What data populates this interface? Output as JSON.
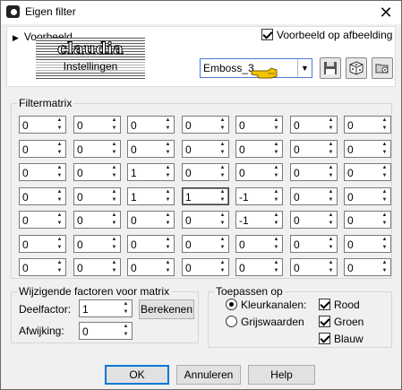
{
  "window": {
    "title": "Eigen filter"
  },
  "preview": {
    "toggle_label": "Voorbeeld",
    "show_on_image_label": "Voorbeeld op afbeelding",
    "show_on_image_checked": true
  },
  "logo": {
    "line1": "claudia",
    "line2": "Instellingen"
  },
  "preset": {
    "selected": "Emboss_3"
  },
  "matrix": {
    "legend": "Filtermatrix",
    "rows": [
      [
        "0",
        "0",
        "0",
        "0",
        "0",
        "0",
        "0"
      ],
      [
        "0",
        "0",
        "0",
        "0",
        "0",
        "0",
        "0"
      ],
      [
        "0",
        "0",
        "1",
        "0",
        "0",
        "0",
        "0"
      ],
      [
        "0",
        "0",
        "1",
        "1",
        "-1",
        "0",
        "0"
      ],
      [
        "0",
        "0",
        "0",
        "0",
        "-1",
        "0",
        "0"
      ],
      [
        "0",
        "0",
        "0",
        "0",
        "0",
        "0",
        "0"
      ],
      [
        "0",
        "0",
        "0",
        "0",
        "0",
        "0",
        "0"
      ]
    ]
  },
  "factors": {
    "legend": "Wijzigende factoren voor matrix",
    "divisor_label": "Deelfactor:",
    "divisor_value": "1",
    "bias_label": "Afwijking:",
    "bias_value": "0",
    "compute_label": "Berekenen"
  },
  "apply": {
    "legend": "Toepassen op",
    "color_channels_label": "Kleurkanalen:",
    "grayscale_label": "Grijswaarden",
    "mode": "color",
    "red_label": "Rood",
    "green_label": "Groen",
    "blue_label": "Blauw",
    "red_checked": true,
    "green_checked": true,
    "blue_checked": true
  },
  "footer": {
    "ok_label": "OK",
    "cancel_label": "Annuleren",
    "help_label": "Help"
  },
  "colors": {
    "accent": "#0078d7",
    "pointer": "#f2c500",
    "select_border": "#4a7ad6"
  }
}
